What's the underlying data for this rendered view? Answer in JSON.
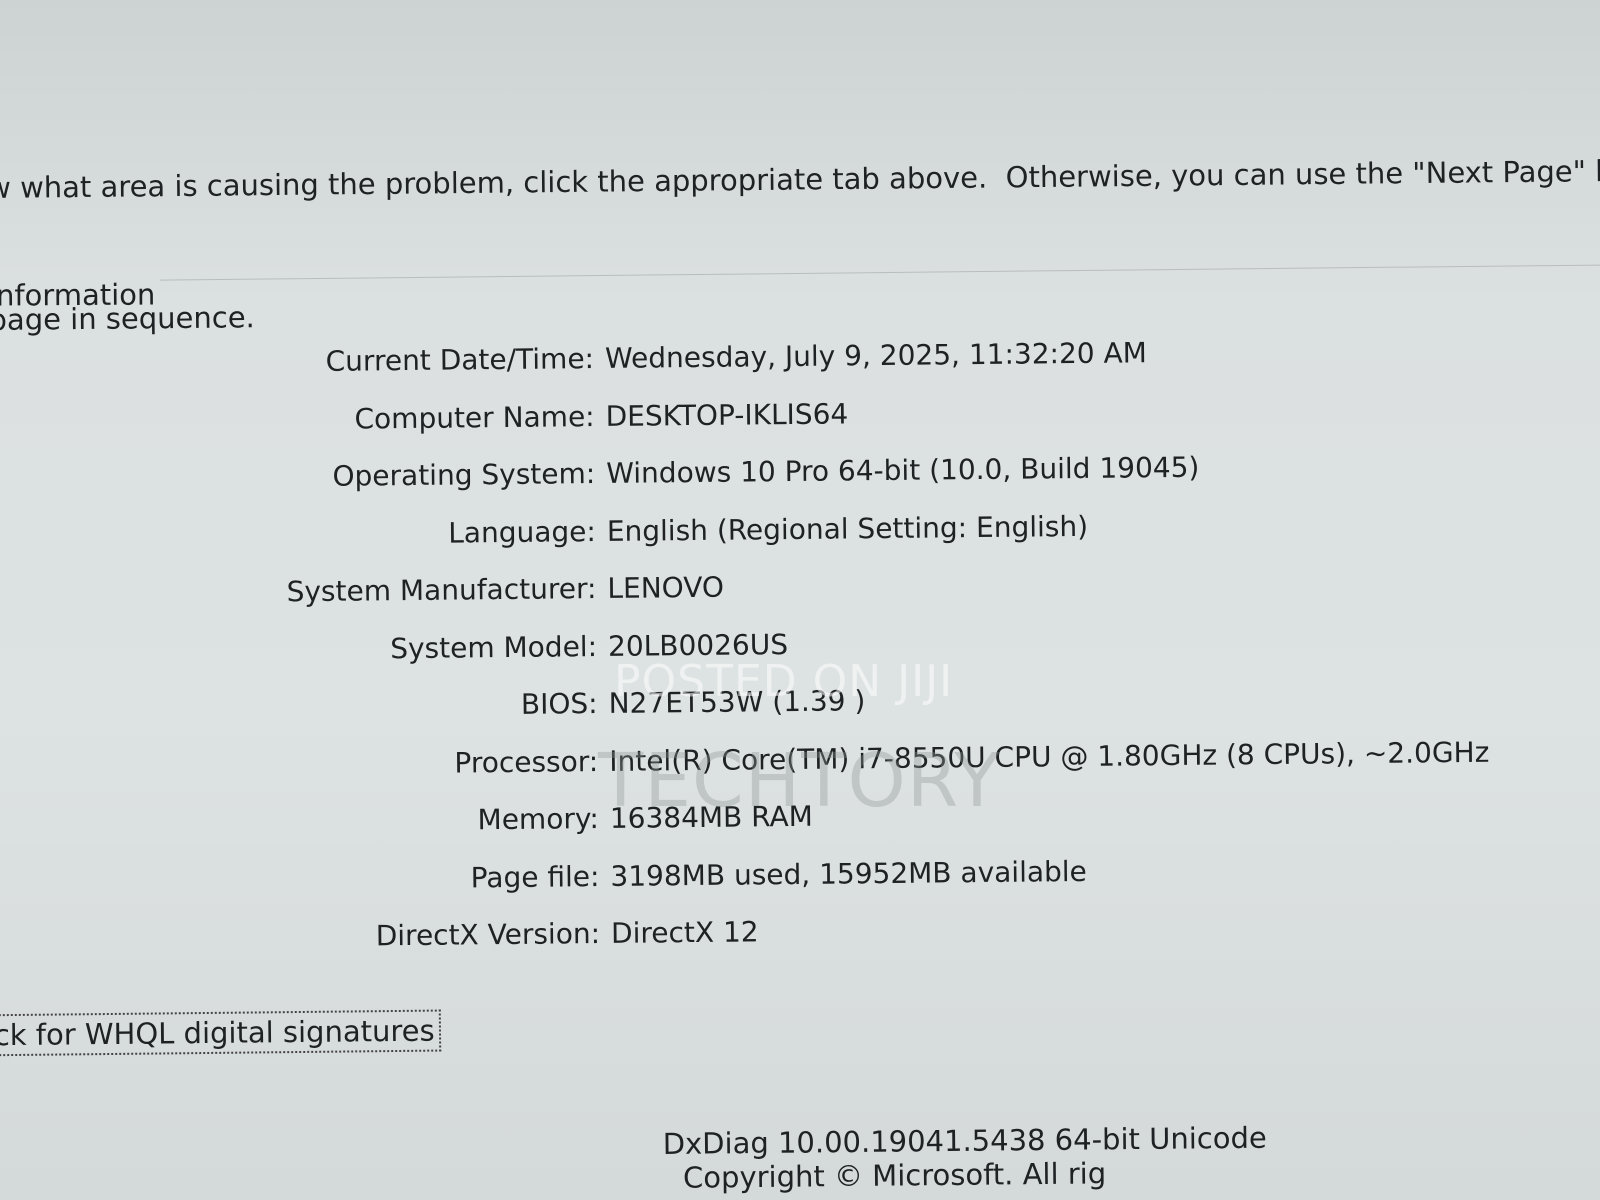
{
  "intro": {
    "line1": "w what area is causing the problem, click the appropriate tab above.  Otherwise, you can use the \"Next Page\" bu",
    "line2": "page in sequence."
  },
  "group_title": "nformation",
  "system_info": [
    {
      "label": "Current Date/Time:",
      "value": "Wednesday, July 9, 2025, 11:32:20 AM"
    },
    {
      "label": "Computer Name:",
      "value": "DESKTOP-IKLIS64"
    },
    {
      "label": "Operating System:",
      "value": "Windows 10 Pro 64-bit (10.0, Build 19045)"
    },
    {
      "label": "Language:",
      "value": "English (Regional Setting: English)"
    },
    {
      "label": "System Manufacturer:",
      "value": "LENOVO"
    },
    {
      "label": "System Model:",
      "value": "20LB0026US"
    },
    {
      "label": "BIOS:",
      "value": "N27ET53W (1.39 )"
    },
    {
      "label": "Processor:",
      "value": "Intel(R) Core(TM) i7-8550U CPU @ 1.80GHz (8 CPUs), ~2.0GHz"
    },
    {
      "label": "Memory:",
      "value": "16384MB RAM"
    },
    {
      "label": "Page file:",
      "value": "3198MB used, 15952MB available"
    },
    {
      "label": "DirectX Version:",
      "value": "DirectX 12"
    }
  ],
  "watermark": {
    "top": "POSTED ON JIJI",
    "brand": "TECHTORY"
  },
  "whql_checkbox_label": "eck for WHQL digital signatures",
  "footer": {
    "version": "DxDiag 10.00.19041.5438 64-bit Unicode",
    "copyright": "Copyright © Microsoft. All rig"
  }
}
